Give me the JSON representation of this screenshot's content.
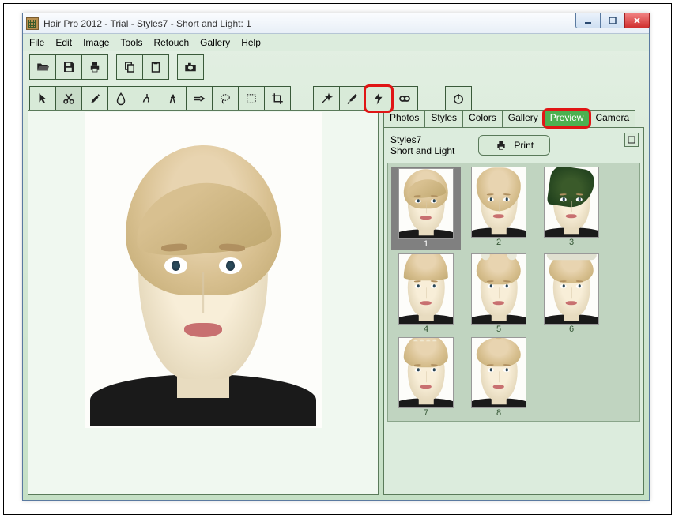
{
  "window": {
    "title": "Hair Pro 2012 - Trial - Styles7 - Short and Light: 1"
  },
  "menu": {
    "file": "File",
    "edit": "Edit",
    "image": "Image",
    "tools": "Tools",
    "retouch": "Retouch",
    "gallery": "Gallery",
    "help": "Help"
  },
  "brand": "  ",
  "tabs": {
    "photos": "Photos",
    "styles": "Styles",
    "colors": "Colors",
    "gallery": "Gallery",
    "preview": "Preview",
    "camera": "Camera"
  },
  "panel": {
    "line1": "Styles7",
    "line2": "Short and Light",
    "print": "Print"
  },
  "thumbs": [
    {
      "num": "1"
    },
    {
      "num": "2"
    },
    {
      "num": "3"
    },
    {
      "num": "4"
    },
    {
      "num": "5"
    },
    {
      "num": "6"
    },
    {
      "num": "7"
    },
    {
      "num": "8"
    }
  ],
  "colors": {
    "highlight": "#e01515",
    "accent": "#4cb050"
  }
}
